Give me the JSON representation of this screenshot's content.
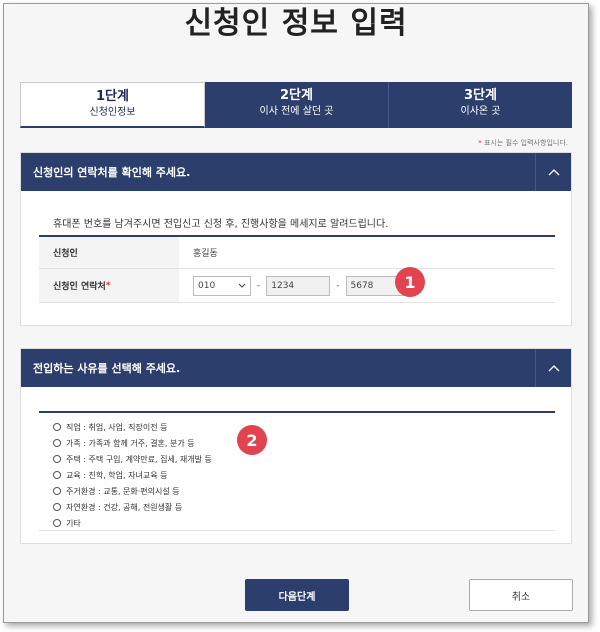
{
  "page": {
    "title": "신청인 정보 입력"
  },
  "tabs": [
    {
      "step": "1단계",
      "name": "신청인정보",
      "active": true
    },
    {
      "step": "2단계",
      "name": "이사 전에 살던 곳",
      "active": false
    },
    {
      "step": "3단계",
      "name": "이사온 곳",
      "active": false
    }
  ],
  "required_note": {
    "star": "*",
    "text": "표시는 필수 입력사항입니다."
  },
  "contact_section": {
    "heading": "신청인의 연락처를 확인해 주세요.",
    "guide": "휴대폰 번호를 남겨주시면 전입신고 신청 후, 진행사항을 메세지로 알려드립니다.",
    "applicant_label": "신청인",
    "applicant_value": "홍길동",
    "phone_label": "신청인 연락처",
    "phone_required_mark": "*",
    "phone_prefix": "010",
    "phone_mid": "1234",
    "phone_last": "5678",
    "phone_separator": "-"
  },
  "reason_section": {
    "heading": "전입하는 사유를 선택해 주세요.",
    "options": [
      "직업 : 취업, 사업, 직장이전 등",
      "가족 : 가족과 함께 거주, 결혼, 분가 등",
      "주택 : 주택 구입, 계약만료, 집세, 재개발 등",
      "교육 : 진학, 학업, 자녀교육 등",
      "주거환경 : 교통, 문화·편의시설 등",
      "자연환경 : 건강, 공해, 전원생활 등",
      "기타"
    ]
  },
  "annotations": {
    "badge1": "1",
    "badge2": "2"
  },
  "buttons": {
    "next": "다음단계",
    "cancel": "취소"
  },
  "colors": {
    "navy": "#2c3e6b",
    "required": "#d0333d",
    "badge": "#e2444f"
  },
  "icons": {
    "section_toggle": "chevron-up-icon",
    "select_arrow": "chevron-down-icon",
    "radio": "radio-unchecked-icon"
  }
}
